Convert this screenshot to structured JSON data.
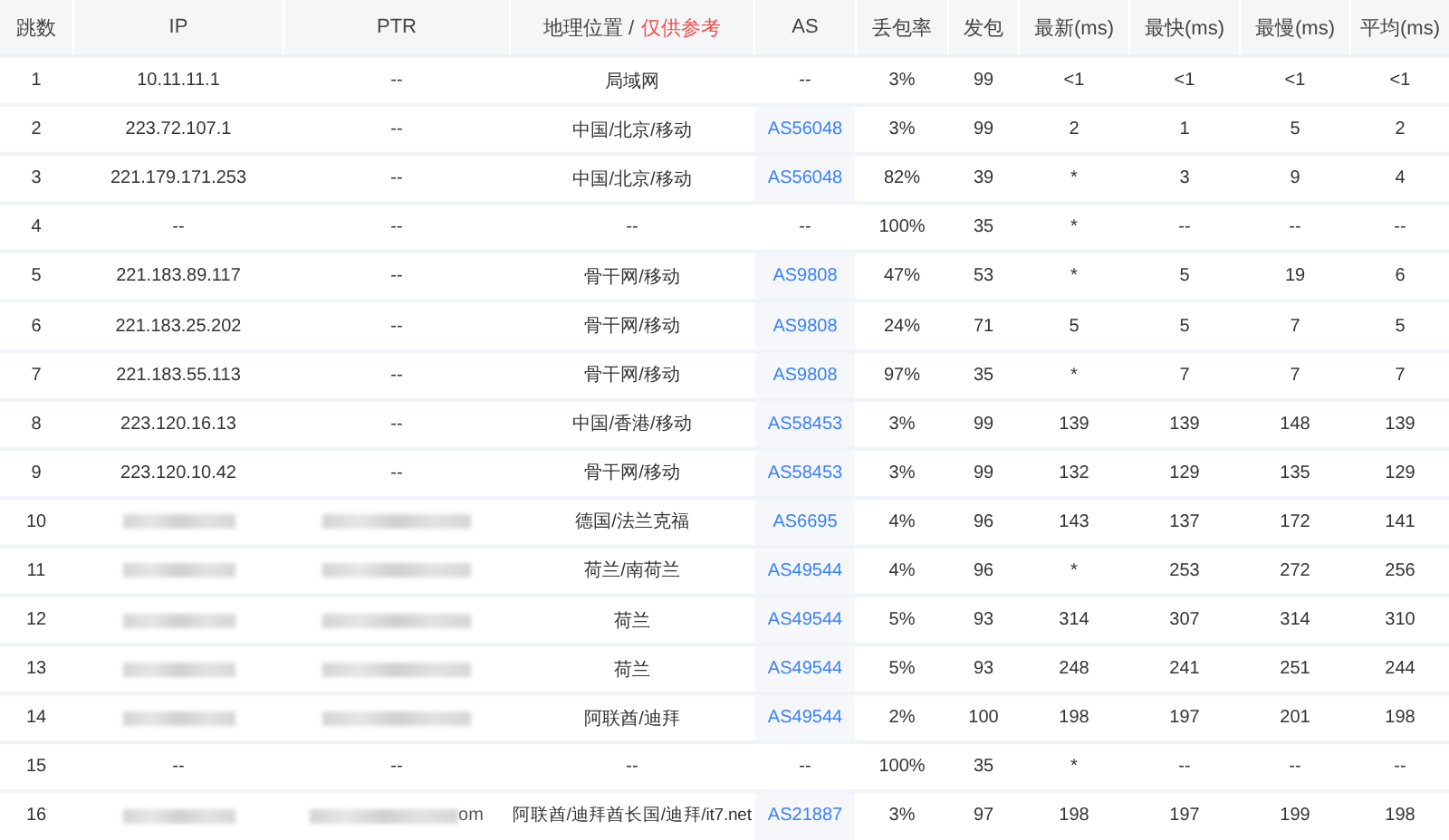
{
  "table": {
    "columns": [
      {
        "label": "跳数"
      },
      {
        "label": "IP"
      },
      {
        "label": "PTR"
      },
      {
        "label": "地理位置 /",
        "note": "仅供参考"
      },
      {
        "label": "AS"
      },
      {
        "label": "丢包率"
      },
      {
        "label": "发包"
      },
      {
        "label": "最新(ms)"
      },
      {
        "label": "最快(ms)"
      },
      {
        "label": "最慢(ms)"
      },
      {
        "label": "平均(ms)"
      }
    ],
    "rows": [
      {
        "hop": "1",
        "ip": "10.11.11.1",
        "ptr": "--",
        "location": "局域网",
        "as": {
          "text": "--",
          "link": false
        },
        "loss": "3%",
        "sent": "99",
        "last": "<1",
        "best": "<1",
        "worst": "<1",
        "avg": "<1"
      },
      {
        "hop": "2",
        "ip": "223.72.107.1",
        "ptr": "--",
        "location": "中国/北京/移动",
        "as": {
          "text": "AS56048",
          "link": true
        },
        "loss": "3%",
        "sent": "99",
        "last": "2",
        "best": "1",
        "worst": "5",
        "avg": "2"
      },
      {
        "hop": "3",
        "ip": "221.179.171.253",
        "ptr": "--",
        "location": "中国/北京/移动",
        "as": {
          "text": "AS56048",
          "link": true
        },
        "loss": "82%",
        "sent": "39",
        "last": "*",
        "best": "3",
        "worst": "9",
        "avg": "4"
      },
      {
        "hop": "4",
        "ip": "--",
        "ptr": "--",
        "location": "--",
        "as": {
          "text": "--",
          "link": false
        },
        "loss": "100%",
        "sent": "35",
        "last": "*",
        "best": "--",
        "worst": "--",
        "avg": "--"
      },
      {
        "hop": "5",
        "ip": "221.183.89.117",
        "ptr": "--",
        "location": "骨干网/移动",
        "as": {
          "text": "AS9808",
          "link": true
        },
        "loss": "47%",
        "sent": "53",
        "last": "*",
        "best": "5",
        "worst": "19",
        "avg": "6"
      },
      {
        "hop": "6",
        "ip": "221.183.25.202",
        "ptr": "--",
        "location": "骨干网/移动",
        "as": {
          "text": "AS9808",
          "link": true
        },
        "loss": "24%",
        "sent": "71",
        "last": "5",
        "best": "5",
        "worst": "7",
        "avg": "5"
      },
      {
        "hop": "7",
        "ip": "221.183.55.113",
        "ptr": "--",
        "location": "骨干网/移动",
        "as": {
          "text": "AS9808",
          "link": true
        },
        "loss": "97%",
        "sent": "35",
        "last": "*",
        "best": "7",
        "worst": "7",
        "avg": "7"
      },
      {
        "hop": "8",
        "ip": "223.120.16.13",
        "ptr": "--",
        "location": "中国/香港/移动",
        "as": {
          "text": "AS58453",
          "link": true
        },
        "loss": "3%",
        "sent": "99",
        "last": "139",
        "best": "139",
        "worst": "148",
        "avg": "139"
      },
      {
        "hop": "9",
        "ip": "223.120.10.42",
        "ptr": "--",
        "location": "骨干网/移动",
        "as": {
          "text": "AS58453",
          "link": true
        },
        "loss": "3%",
        "sent": "99",
        "last": "132",
        "best": "129",
        "worst": "135",
        "avg": "129"
      },
      {
        "hop": "10",
        "ip": {
          "redacted": true
        },
        "ptr": {
          "redacted": true
        },
        "location": "德国/法兰克福",
        "as": {
          "text": "AS6695",
          "link": true
        },
        "loss": "4%",
        "sent": "96",
        "last": "143",
        "best": "137",
        "worst": "172",
        "avg": "141"
      },
      {
        "hop": "11",
        "ip": {
          "redacted": true
        },
        "ptr": {
          "redacted": true
        },
        "location": "荷兰/南荷兰",
        "as": {
          "text": "AS49544",
          "link": true
        },
        "loss": "4%",
        "sent": "96",
        "last": "*",
        "best": "253",
        "worst": "272",
        "avg": "256"
      },
      {
        "hop": "12",
        "ip": {
          "redacted": true
        },
        "ptr": {
          "redacted": true
        },
        "location": "荷兰",
        "as": {
          "text": "AS49544",
          "link": true
        },
        "loss": "5%",
        "sent": "93",
        "last": "314",
        "best": "307",
        "worst": "314",
        "avg": "310"
      },
      {
        "hop": "13",
        "ip": {
          "redacted": true
        },
        "ptr": {
          "redacted": true
        },
        "location": "荷兰",
        "as": {
          "text": "AS49544",
          "link": true
        },
        "loss": "5%",
        "sent": "93",
        "last": "248",
        "best": "241",
        "worst": "251",
        "avg": "244"
      },
      {
        "hop": "14",
        "ip": {
          "redacted": true
        },
        "ptr": {
          "redacted": true
        },
        "location": "阿联酋/迪拜",
        "as": {
          "text": "AS49544",
          "link": true
        },
        "loss": "2%",
        "sent": "100",
        "last": "198",
        "best": "197",
        "worst": "201",
        "avg": "198"
      },
      {
        "hop": "15",
        "ip": "--",
        "ptr": "--",
        "location": "--",
        "as": {
          "text": "--",
          "link": false
        },
        "loss": "100%",
        "sent": "35",
        "last": "*",
        "best": "--",
        "worst": "--",
        "avg": "--"
      },
      {
        "hop": "16",
        "ip": {
          "redacted": true
        },
        "ptr": {
          "redacted": true,
          "tail": "om"
        },
        "location": "阿联酋/迪拜酋长国/迪拜/it7.net",
        "as": {
          "text": "AS21887",
          "link": true
        },
        "loss": "3%",
        "sent": "97",
        "last": "198",
        "best": "197",
        "worst": "199",
        "avg": "198"
      }
    ]
  }
}
